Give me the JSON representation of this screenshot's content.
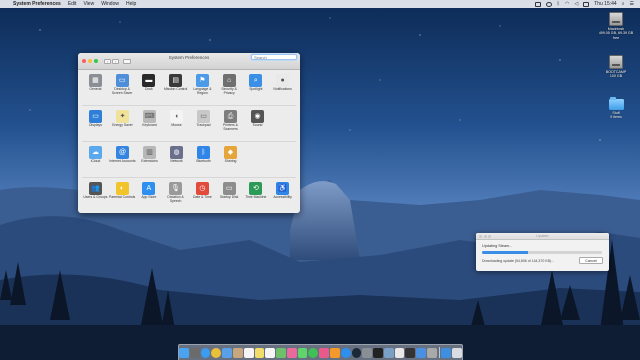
{
  "menubar": {
    "apple_icon": "apple-logo-icon",
    "app_name": "System Preferences",
    "menus": [
      "Edit",
      "View",
      "Window",
      "Help"
    ],
    "clock": "Thu 15:44"
  },
  "desktop_icons": [
    {
      "name": "macintosh-hd",
      "label": "Macintosh",
      "sublabel": "499.05 GB, 69.39 GB free",
      "type": "drive"
    },
    {
      "name": "bootcamp",
      "label": "BOOTCAMP",
      "sublabel": "100 GB",
      "type": "drive"
    },
    {
      "name": "stuff-folder",
      "label": "Stuff",
      "sublabel": "9 items",
      "type": "folder"
    }
  ],
  "sysprefs": {
    "title": "System Preferences",
    "search_placeholder": "Search",
    "rows": [
      [
        {
          "label": "General",
          "icon": "general-icon",
          "color": "#8a8f96",
          "glyph": "▦"
        },
        {
          "label": "Desktop & Screen Saver",
          "icon": "desktop-icon",
          "color": "#4f8fd9",
          "glyph": "▭"
        },
        {
          "label": "Dock",
          "icon": "dock-icon",
          "color": "#2a2a2a",
          "glyph": "▬"
        },
        {
          "label": "Mission Control",
          "icon": "mission-control-icon",
          "color": "#3a3a3a",
          "glyph": "▤"
        },
        {
          "label": "Language & Region",
          "icon": "flag-icon",
          "color": "#4c9be8",
          "glyph": "⚑"
        },
        {
          "label": "Security & Privacy",
          "icon": "lock-house-icon",
          "color": "#6f6f6f",
          "glyph": "⌂"
        },
        {
          "label": "Spotlight",
          "icon": "spotlight-icon",
          "color": "#3b8fe6",
          "glyph": "⌕"
        },
        {
          "label": "Notifications",
          "icon": "notifications-icon",
          "color": "#e9e9e9",
          "glyph": "●"
        }
      ],
      [
        {
          "label": "Displays",
          "icon": "displays-icon",
          "color": "#2f7fd8",
          "glyph": "▭"
        },
        {
          "label": "Energy Saver",
          "icon": "bulb-icon",
          "color": "#f1e29a",
          "glyph": "✦"
        },
        {
          "label": "Keyboard",
          "icon": "keyboard-icon",
          "color": "#b9b9b9",
          "glyph": "⌨"
        },
        {
          "label": "Mouse",
          "icon": "mouse-icon",
          "color": "#f4f4f4",
          "glyph": "◖"
        },
        {
          "label": "Trackpad",
          "icon": "trackpad-icon",
          "color": "#c8c8c8",
          "glyph": "▭"
        },
        {
          "label": "Printers & Scanners",
          "icon": "printer-icon",
          "color": "#7d7d7d",
          "glyph": "⎙"
        },
        {
          "label": "Sound",
          "icon": "speaker-icon",
          "color": "#555555",
          "glyph": "◉"
        }
      ],
      [
        {
          "label": "iCloud",
          "icon": "icloud-icon",
          "color": "#5aa9ef",
          "glyph": "☁"
        },
        {
          "label": "Internet Accounts",
          "icon": "at-icon",
          "color": "#3585e0",
          "glyph": "@"
        },
        {
          "label": "Extensions",
          "icon": "extensions-icon",
          "color": "#b7b7b7",
          "glyph": "▥"
        },
        {
          "label": "Network",
          "icon": "network-globe-icon",
          "color": "#6a6f8c",
          "glyph": "◍"
        },
        {
          "label": "Bluetooth",
          "icon": "bluetooth-icon",
          "color": "#2f86e8",
          "glyph": "ᛒ"
        },
        {
          "label": "Sharing",
          "icon": "sharing-icon",
          "color": "#e6a53a",
          "glyph": "◆"
        }
      ],
      [
        {
          "label": "Users & Groups",
          "icon": "users-icon",
          "color": "#555555",
          "glyph": "👥"
        },
        {
          "label": "Parental Controls",
          "icon": "parental-icon",
          "color": "#f2c42c",
          "glyph": "◐"
        },
        {
          "label": "App Store",
          "icon": "app-store-icon",
          "color": "#2d8ff0",
          "glyph": "A"
        },
        {
          "label": "Dictation & Speech",
          "icon": "microphone-icon",
          "color": "#9a9a9a",
          "glyph": "🎙"
        },
        {
          "label": "Date & Time",
          "icon": "calendar-clock-icon",
          "color": "#e24b3b",
          "glyph": "◷"
        },
        {
          "label": "Startup Disk",
          "icon": "startup-disk-icon",
          "color": "#8d8d8d",
          "glyph": "▭"
        },
        {
          "label": "Time Machine",
          "icon": "time-machine-icon",
          "color": "#2e9a58",
          "glyph": "⟲"
        },
        {
          "label": "Accessibility",
          "icon": "accessibility-icon",
          "color": "#2f86e8",
          "glyph": "♿"
        }
      ]
    ]
  },
  "update_dialog": {
    "title": "Updater",
    "status": "Updating Steam...",
    "detail": "Downloading update (54,806 of 144,370 KB)...",
    "progress": 0.38,
    "cancel_label": "Cancel"
  },
  "dock": {
    "items": [
      {
        "name": "finder-icon",
        "color": "#4aa3f0"
      },
      {
        "name": "launchpad-icon",
        "color": "#6b6b6b"
      },
      {
        "name": "safari-icon",
        "color": "#3b9cf0"
      },
      {
        "name": "chrome-icon",
        "color": "#e8c03a"
      },
      {
        "name": "mail-icon",
        "color": "#5aa0e8"
      },
      {
        "name": "contacts-icon",
        "color": "#c9a77c"
      },
      {
        "name": "calendar-icon",
        "color": "#f5f5f5"
      },
      {
        "name": "notes-icon",
        "color": "#f2dd6a"
      },
      {
        "name": "reminders-icon",
        "color": "#f5f5f5"
      },
      {
        "name": "maps-icon",
        "color": "#6fc06b"
      },
      {
        "name": "photos-icon",
        "color": "#e96a9b"
      },
      {
        "name": "messages-icon",
        "color": "#5ed46a"
      },
      {
        "name": "facetime-icon",
        "color": "#3fbf55"
      },
      {
        "name": "itunes-icon",
        "color": "#e95a8c"
      },
      {
        "name": "ibooks-icon",
        "color": "#f39a2b"
      },
      {
        "name": "app-store-dock-icon",
        "color": "#2d8ff0"
      },
      {
        "name": "steam-icon",
        "color": "#1b2838"
      },
      {
        "name": "sysprefs-dock-icon",
        "color": "#8a8f96"
      },
      {
        "name": "terminal-icon",
        "color": "#222222"
      },
      {
        "name": "preview-icon",
        "color": "#7aa0c8"
      },
      {
        "name": "textedit-icon",
        "color": "#e8e8e8"
      },
      {
        "name": "activity-monitor-icon",
        "color": "#333333"
      },
      {
        "name": "xcode-icon",
        "color": "#4a8fe0"
      },
      {
        "name": "utility-icon",
        "color": "#a9a9a9"
      }
    ],
    "trailing": [
      {
        "name": "downloads-stack-icon",
        "color": "#3f8fe0"
      },
      {
        "name": "trash-icon",
        "color": "#d9dde2"
      }
    ]
  }
}
